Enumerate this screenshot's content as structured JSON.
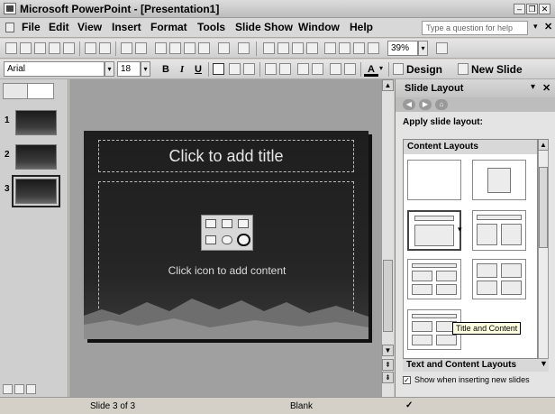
{
  "window": {
    "title": "Microsoft PowerPoint - [Presentation1]"
  },
  "menu": {
    "items": [
      {
        "label": "File"
      },
      {
        "label": "Edit"
      },
      {
        "label": "View"
      },
      {
        "label": "Insert"
      },
      {
        "label": "Format"
      },
      {
        "label": "Tools"
      },
      {
        "label": "Slide Show"
      },
      {
        "label": "Window"
      },
      {
        "label": "Help"
      }
    ],
    "ask_placeholder": "Type a question for help"
  },
  "standard_toolbar": {
    "zoom_value": "39%"
  },
  "formatting_toolbar": {
    "font": "Arial",
    "size": "18",
    "bold": "B",
    "italic": "I",
    "underline": "U",
    "design_label": "Design",
    "new_slide_label": "New Slide"
  },
  "thumbnails": {
    "numbers": [
      "1",
      "2",
      "3"
    ]
  },
  "slide": {
    "title_placeholder": "Click to add title",
    "content_placeholder": "Click icon to add content"
  },
  "task_pane": {
    "title": "Slide Layout",
    "apply_label": "Apply slide layout:",
    "content_layouts_header": "Content Layouts",
    "tooltip": "Title and Content",
    "text_content_header": "Text and Content Layouts",
    "show_when_label": "Show when inserting new slides"
  },
  "status": {
    "slide_of": "Slide 3 of 3",
    "design": "Blank"
  }
}
